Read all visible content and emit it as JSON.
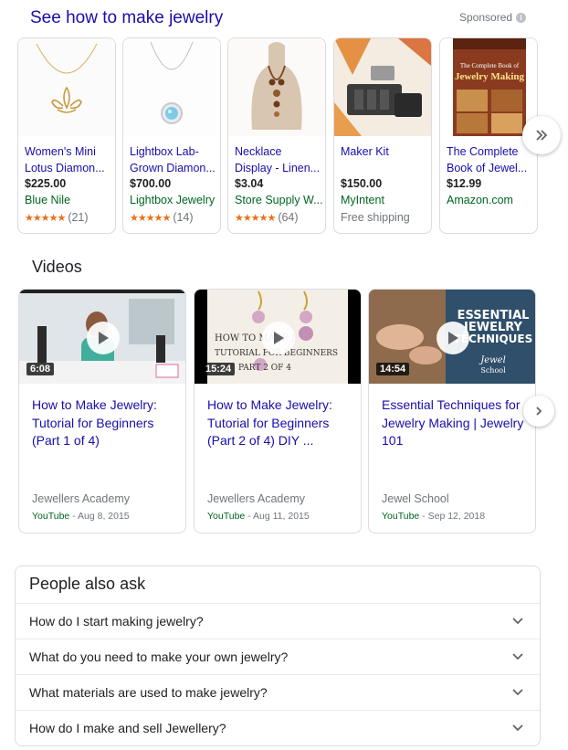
{
  "shopping": {
    "title": "See how to make jewelry",
    "sponsored": "Sponsored",
    "info_icon": "i",
    "products": [
      {
        "name_line1": "Women's Mini",
        "name_line2": "Lotus Diamon...",
        "price": "$225.00",
        "store": "Blue Nile",
        "stars": "★★★★★",
        "reviews": "(21)"
      },
      {
        "name_line1": "Lightbox Lab-",
        "name_line2": "Grown Diamon...",
        "price": "$700.00",
        "store": "Lightbox Jewelry",
        "stars": "★★★★★",
        "reviews": "(14)"
      },
      {
        "name_line1": "Necklace",
        "name_line2": "Display - Linen...",
        "price": "$3.04",
        "store": "Store Supply W...",
        "stars": "★★★★★",
        "reviews": "(64)"
      },
      {
        "name_line1": "Maker Kit",
        "name_line2": "",
        "price": "$150.00",
        "store": "MyIntent",
        "extra": "Free shipping"
      },
      {
        "name_line1": "The Complete",
        "name_line2": "Book of Jewel...",
        "price": "$12.99",
        "store": "Amazon.com",
        "book_line1": "The Complete Book of",
        "book_line2": "Jewelry Making"
      }
    ],
    "next_icon": "double-chevron-right-icon"
  },
  "videos": {
    "title": "Videos",
    "items": [
      {
        "duration": "6:08",
        "title": "How to Make Jewelry: Tutorial for Beginners (Part 1 of 4)",
        "channel": "Jewellers Academy",
        "source": "YouTube",
        "date": " - Aug 8, 2015"
      },
      {
        "duration": "15:24",
        "title": "How to Make Jewelry: Tutorial for Beginners (Part 2 of 4) DIY ...",
        "channel": "Jewellers Academy",
        "source": "YouTube",
        "date": " - Aug 11, 2015",
        "thumb_line1": "HOW TO MAKE J",
        "thumb_line2": "TUTORIAL FOR BEGINNERS",
        "thumb_line3": "PART 2 OF 4"
      },
      {
        "duration": "14:54",
        "title": "Essential Techniques for Jewelry Making | Jewelry 101",
        "channel": "Jewel School",
        "source": "YouTube",
        "date": " - Sep 12, 2018",
        "thumb_line1": "ESSENTIAL",
        "thumb_line2": "JEWELRY",
        "thumb_line3": "TECHNIQUES",
        "thumb_line4": "Jewel",
        "thumb_line5": "School"
      }
    ],
    "next_icon": "chevron-right-icon"
  },
  "people_also_ask": {
    "title": "People also ask",
    "questions": [
      "How do I start making jewelry?",
      "What do you need to make your own jewelry?",
      "What materials are used to make jewelry?",
      "How do I make and sell Jewellery?"
    ]
  }
}
